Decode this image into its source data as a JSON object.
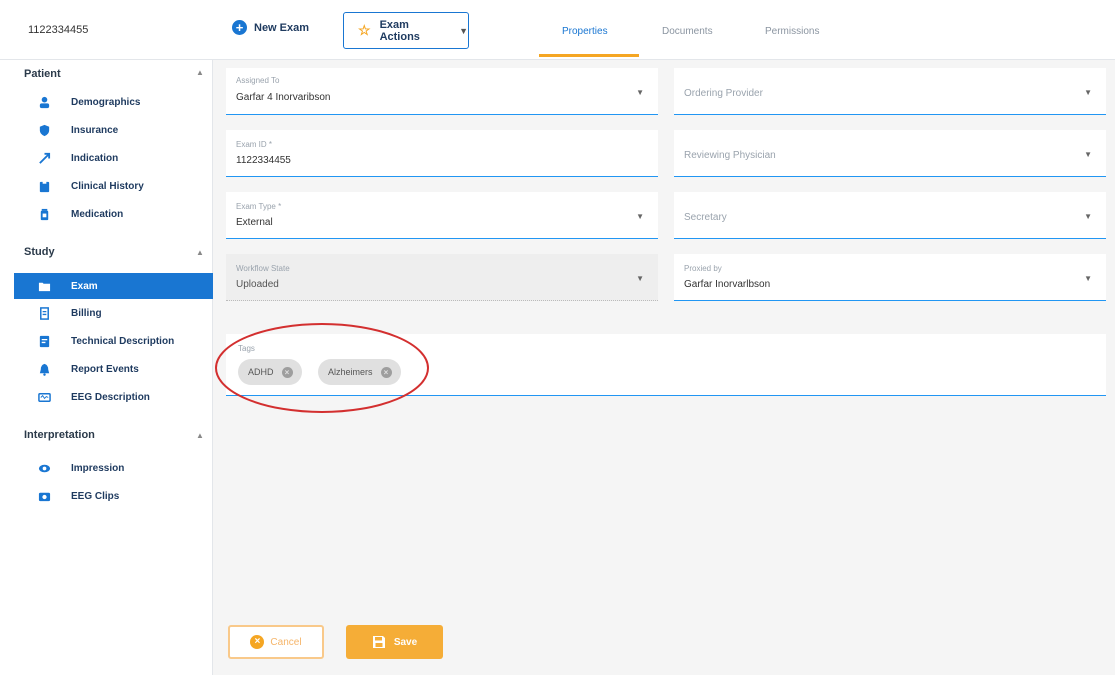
{
  "header": {
    "exam_id": "1122334455",
    "new_exam_label": "New Exam",
    "exam_actions_label": "Exam Actions",
    "tabs": [
      {
        "label": "Properties",
        "active": true
      },
      {
        "label": "Documents",
        "active": false
      },
      {
        "label": "Permissions",
        "active": false
      }
    ]
  },
  "sidebar": {
    "sections": [
      {
        "title": "Patient",
        "items": [
          "Demographics",
          "Insurance",
          "Indication",
          "Clinical History",
          "Medication"
        ]
      },
      {
        "title": "Study",
        "items": [
          "Exam",
          "Billing",
          "Technical Description",
          "Report Events",
          "EEG Description"
        ]
      },
      {
        "title": "Interpretation",
        "items": [
          "Impression",
          "EEG Clips"
        ]
      }
    ],
    "active_item": "Exam"
  },
  "form": {
    "assigned_to": {
      "label": "Assigned To",
      "value": "Garfar 4 Inorvaribson"
    },
    "ordering_provider": {
      "label": "Ordering Provider"
    },
    "exam_id": {
      "label": "Exam ID *",
      "value": "1122334455"
    },
    "reviewing_physician": {
      "label": "Reviewing Physician"
    },
    "exam_type": {
      "label": "Exam Type *",
      "value": "External"
    },
    "secretary": {
      "label": "Secretary"
    },
    "workflow_state": {
      "label": "Workflow State",
      "value": "Uploaded"
    },
    "proxied_by": {
      "label": "Proxied by",
      "value": "Garfar Inorvarlbson"
    },
    "tags": {
      "label": "Tags",
      "chips": [
        "ADHD",
        "Alzheimers"
      ]
    }
  },
  "actions": {
    "cancel_label": "Cancel",
    "save_label": "Save"
  },
  "colors": {
    "primary": "#1976d2",
    "accent": "#f5a623",
    "annotation": "#d32f2f"
  }
}
